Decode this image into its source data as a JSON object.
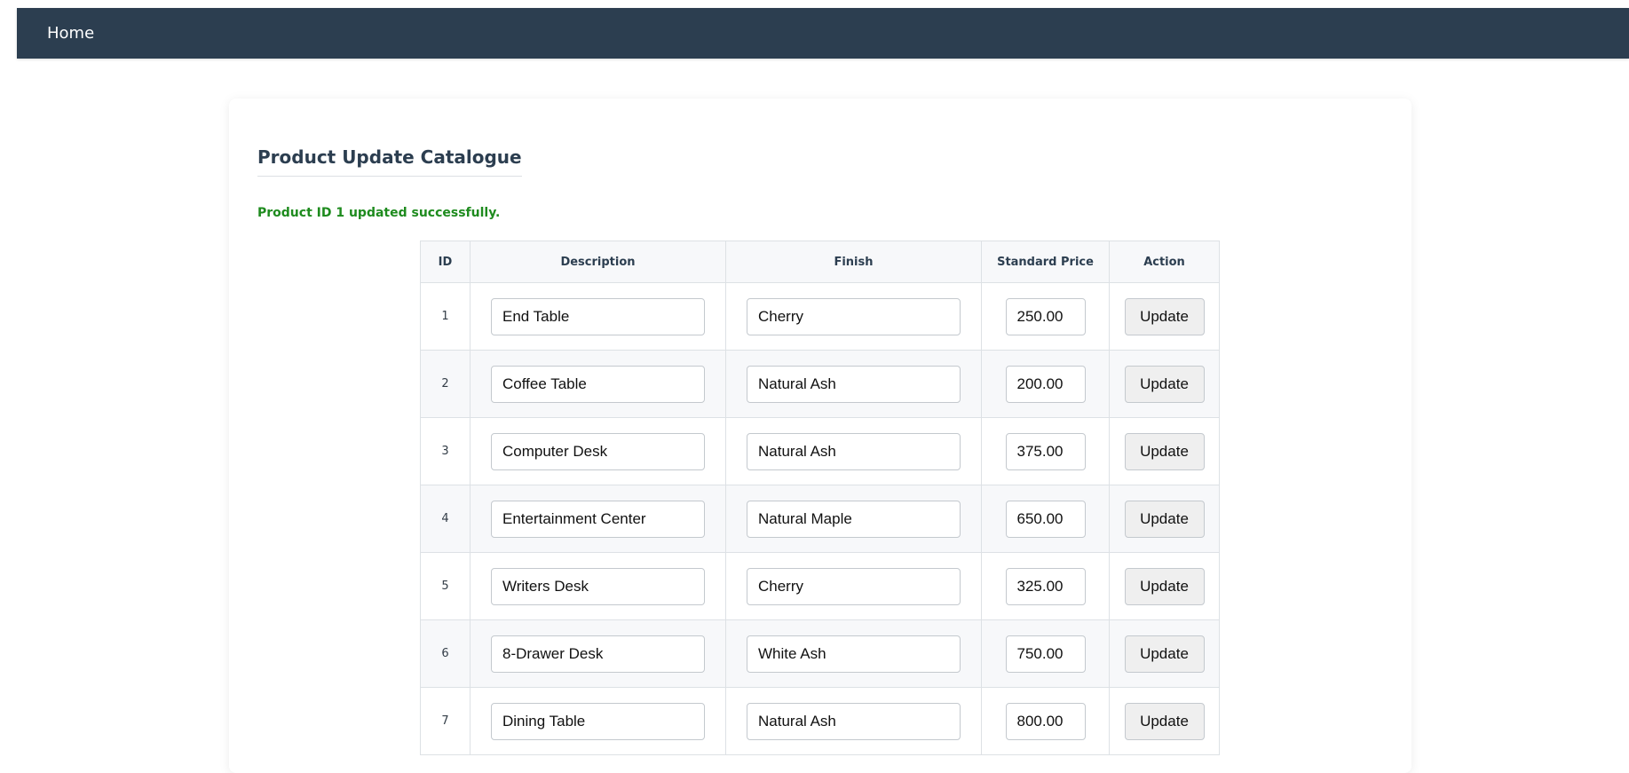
{
  "nav": {
    "home_label": "Home"
  },
  "page": {
    "title": "Product Update Catalogue",
    "status_message": "Product ID 1 updated successfully."
  },
  "table": {
    "columns": [
      "ID",
      "Description",
      "Finish",
      "Standard Price",
      "Action"
    ],
    "rows": [
      {
        "id": "1",
        "description": "End Table",
        "finish": "Cherry",
        "price": "250.00",
        "action": "Update"
      },
      {
        "id": "2",
        "description": "Coffee Table",
        "finish": "Natural Ash",
        "price": "200.00",
        "action": "Update"
      },
      {
        "id": "3",
        "description": "Computer Desk",
        "finish": "Natural Ash",
        "price": "375.00",
        "action": "Update"
      },
      {
        "id": "4",
        "description": "Entertainment Center",
        "finish": "Natural Maple",
        "price": "650.00",
        "action": "Update"
      },
      {
        "id": "5",
        "description": "Writers Desk",
        "finish": "Cherry",
        "price": "325.00",
        "action": "Update"
      },
      {
        "id": "6",
        "description": "8-Drawer Desk",
        "finish": "White Ash",
        "price": "750.00",
        "action": "Update"
      },
      {
        "id": "7",
        "description": "Dining Table",
        "finish": "Natural Ash",
        "price": "800.00",
        "action": "Update"
      }
    ]
  },
  "colors": {
    "navbar": "#2c3e50",
    "success": "#1e8b1e",
    "heading": "#2c3e50"
  }
}
